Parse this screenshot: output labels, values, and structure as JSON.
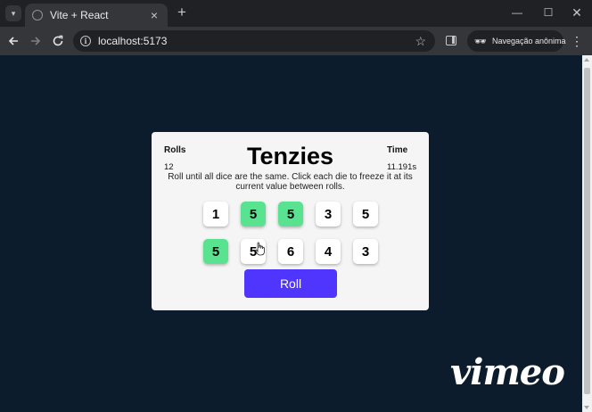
{
  "browser": {
    "tab_title": "Vite + React",
    "tab_close": "×",
    "new_tab": "+",
    "url": "localhost:5173",
    "incognito_label": "Navegação anônima",
    "window_controls": {
      "minimize": "—",
      "maximize": "☐",
      "close": "✕"
    },
    "icons": {
      "tab_search": "chevron-down-icon",
      "back": "arrow-left-icon",
      "forward": "arrow-right-icon",
      "reload": "reload-icon",
      "site_info": "info-icon",
      "bookmark": "star-icon",
      "side_panel": "side-panel-icon",
      "incognito": "incognito-icon",
      "menu": "kebab-menu-icon"
    }
  },
  "app": {
    "title": "Tenzies",
    "instructions": "Roll until all dice are the same. Click each die to freeze it at its current value between rolls.",
    "rolls_label": "Rolls",
    "rolls_value": "12",
    "time_label": "Time",
    "time_value": "11.191s",
    "dice": [
      {
        "value": "1",
        "held": false
      },
      {
        "value": "5",
        "held": true
      },
      {
        "value": "5",
        "held": true
      },
      {
        "value": "3",
        "held": false
      },
      {
        "value": "5",
        "held": false
      },
      {
        "value": "5",
        "held": true
      },
      {
        "value": "5",
        "held": false
      },
      {
        "value": "6",
        "held": false
      },
      {
        "value": "4",
        "held": false
      },
      {
        "value": "3",
        "held": false
      }
    ],
    "roll_button": "Roll",
    "colors": {
      "background": "#0c1c2c",
      "held_die": "#59e391",
      "die": "#ffffff",
      "roll_button": "#5035ff"
    }
  },
  "watermark": "vimeo"
}
